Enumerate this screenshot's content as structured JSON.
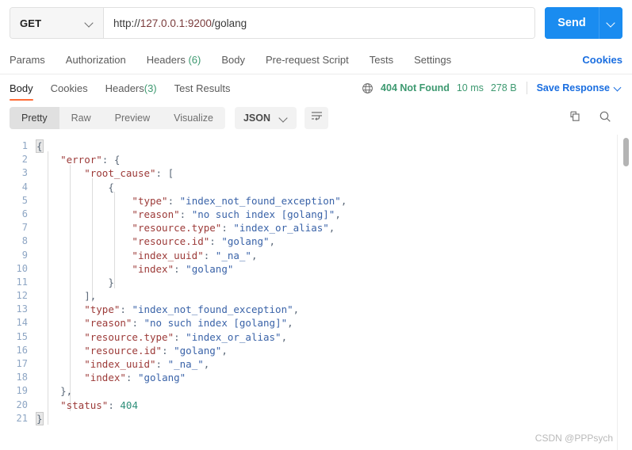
{
  "request_bar": {
    "method": "GET",
    "url_scheme": "http://",
    "url_host": "127.0.0.1:9200",
    "url_path": "/golang",
    "url_full": "http://127.0.0.1:9200/golang",
    "send_label": "Send",
    "send_color": "#1a8cf0"
  },
  "request_tabs": {
    "items": [
      {
        "label": "Params",
        "count": ""
      },
      {
        "label": "Authorization",
        "count": ""
      },
      {
        "label": "Headers",
        "count": "(6)"
      },
      {
        "label": "Body",
        "count": ""
      },
      {
        "label": "Pre-request Script",
        "count": ""
      },
      {
        "label": "Tests",
        "count": ""
      },
      {
        "label": "Settings",
        "count": ""
      }
    ],
    "cookies_link": "Cookies"
  },
  "response_tabs": {
    "items": [
      {
        "label": "Body",
        "count": ""
      },
      {
        "label": "Cookies",
        "count": ""
      },
      {
        "label": "Headers",
        "count": "(3)"
      },
      {
        "label": "Test Results",
        "count": ""
      }
    ],
    "active": "Body",
    "active_underline_color": "#ff6c37"
  },
  "response_meta": {
    "status": "404 Not Found",
    "status_color": "#3d9970",
    "time": "10 ms",
    "size": "278 B",
    "save_response_label": "Save Response"
  },
  "view_toolbar": {
    "segments": [
      "Pretty",
      "Raw",
      "Preview",
      "Visualize"
    ],
    "active_segment": "Pretty",
    "format": "JSON",
    "wrap_icon": "word-wrap-icon",
    "copy_icon": "copy-icon",
    "search_icon": "search-icon"
  },
  "body_lines": [
    {
      "no": "1",
      "indent": 0,
      "tokens": [
        {
          "t": "p",
          "v": "{",
          "hl": true
        }
      ]
    },
    {
      "no": "2",
      "indent": 1,
      "tokens": [
        {
          "t": "k",
          "v": "\"error\""
        },
        {
          "t": "p",
          "v": ": "
        },
        {
          "t": "p",
          "v": "{"
        }
      ]
    },
    {
      "no": "3",
      "indent": 2,
      "tokens": [
        {
          "t": "k",
          "v": "\"root_cause\""
        },
        {
          "t": "p",
          "v": ": "
        },
        {
          "t": "p",
          "v": "["
        }
      ]
    },
    {
      "no": "4",
      "indent": 3,
      "tokens": [
        {
          "t": "p",
          "v": "{"
        }
      ]
    },
    {
      "no": "5",
      "indent": 4,
      "tokens": [
        {
          "t": "k",
          "v": "\"type\""
        },
        {
          "t": "p",
          "v": ": "
        },
        {
          "t": "s",
          "v": "\"index_not_found_exception\""
        },
        {
          "t": "p",
          "v": ","
        }
      ]
    },
    {
      "no": "6",
      "indent": 4,
      "tokens": [
        {
          "t": "k",
          "v": "\"reason\""
        },
        {
          "t": "p",
          "v": ": "
        },
        {
          "t": "s",
          "v": "\"no such index [golang]\""
        },
        {
          "t": "p",
          "v": ","
        }
      ]
    },
    {
      "no": "7",
      "indent": 4,
      "tokens": [
        {
          "t": "k",
          "v": "\"resource.type\""
        },
        {
          "t": "p",
          "v": ": "
        },
        {
          "t": "s",
          "v": "\"index_or_alias\""
        },
        {
          "t": "p",
          "v": ","
        }
      ]
    },
    {
      "no": "8",
      "indent": 4,
      "tokens": [
        {
          "t": "k",
          "v": "\"resource.id\""
        },
        {
          "t": "p",
          "v": ": "
        },
        {
          "t": "s",
          "v": "\"golang\""
        },
        {
          "t": "p",
          "v": ","
        }
      ]
    },
    {
      "no": "9",
      "indent": 4,
      "tokens": [
        {
          "t": "k",
          "v": "\"index_uuid\""
        },
        {
          "t": "p",
          "v": ": "
        },
        {
          "t": "s",
          "v": "\"_na_\""
        },
        {
          "t": "p",
          "v": ","
        }
      ]
    },
    {
      "no": "10",
      "indent": 4,
      "tokens": [
        {
          "t": "k",
          "v": "\"index\""
        },
        {
          "t": "p",
          "v": ": "
        },
        {
          "t": "s",
          "v": "\"golang\""
        }
      ]
    },
    {
      "no": "11",
      "indent": 3,
      "tokens": [
        {
          "t": "p",
          "v": "}"
        }
      ]
    },
    {
      "no": "12",
      "indent": 2,
      "tokens": [
        {
          "t": "p",
          "v": "],"
        }
      ]
    },
    {
      "no": "13",
      "indent": 2,
      "tokens": [
        {
          "t": "k",
          "v": "\"type\""
        },
        {
          "t": "p",
          "v": ": "
        },
        {
          "t": "s",
          "v": "\"index_not_found_exception\""
        },
        {
          "t": "p",
          "v": ","
        }
      ]
    },
    {
      "no": "14",
      "indent": 2,
      "tokens": [
        {
          "t": "k",
          "v": "\"reason\""
        },
        {
          "t": "p",
          "v": ": "
        },
        {
          "t": "s",
          "v": "\"no such index [golang]\""
        },
        {
          "t": "p",
          "v": ","
        }
      ]
    },
    {
      "no": "15",
      "indent": 2,
      "tokens": [
        {
          "t": "k",
          "v": "\"resource.type\""
        },
        {
          "t": "p",
          "v": ": "
        },
        {
          "t": "s",
          "v": "\"index_or_alias\""
        },
        {
          "t": "p",
          "v": ","
        }
      ]
    },
    {
      "no": "16",
      "indent": 2,
      "tokens": [
        {
          "t": "k",
          "v": "\"resource.id\""
        },
        {
          "t": "p",
          "v": ": "
        },
        {
          "t": "s",
          "v": "\"golang\""
        },
        {
          "t": "p",
          "v": ","
        }
      ]
    },
    {
      "no": "17",
      "indent": 2,
      "tokens": [
        {
          "t": "k",
          "v": "\"index_uuid\""
        },
        {
          "t": "p",
          "v": ": "
        },
        {
          "t": "s",
          "v": "\"_na_\""
        },
        {
          "t": "p",
          "v": ","
        }
      ]
    },
    {
      "no": "18",
      "indent": 2,
      "tokens": [
        {
          "t": "k",
          "v": "\"index\""
        },
        {
          "t": "p",
          "v": ": "
        },
        {
          "t": "s",
          "v": "\"golang\""
        }
      ]
    },
    {
      "no": "19",
      "indent": 1,
      "tokens": [
        {
          "t": "p",
          "v": "},"
        }
      ]
    },
    {
      "no": "20",
      "indent": 1,
      "tokens": [
        {
          "t": "k",
          "v": "\"status\""
        },
        {
          "t": "p",
          "v": ": "
        },
        {
          "t": "n",
          "v": "404"
        }
      ]
    },
    {
      "no": "21",
      "indent": 0,
      "tokens": [
        {
          "t": "p",
          "v": "}",
          "hl": true
        }
      ]
    }
  ],
  "watermark": "CSDN @PPPsych",
  "syntax_colors": {
    "key": "#9c3a38",
    "string": "#3a63a8",
    "number": "#2f8f7a",
    "punctuation": "#5a6878",
    "lineno": "#8ea6c4"
  }
}
